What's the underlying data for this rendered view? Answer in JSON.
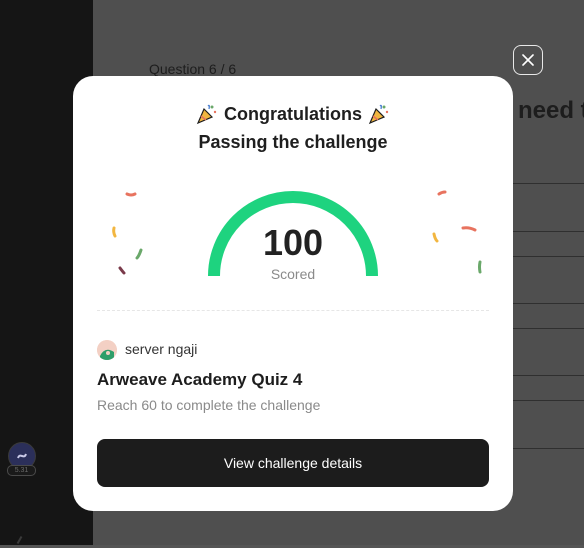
{
  "background": {
    "question_progress": "Question 6 / 6",
    "question_title_fragment": "need t",
    "rail_badge": "5.31"
  },
  "modal": {
    "heading": "Congratulations",
    "subheading": "Passing the challenge",
    "score_value": "100",
    "score_label": "Scored",
    "score_fraction": 1.0,
    "org_name": "server ngaji",
    "quiz_name": "Arweave Academy Quiz 4",
    "quiz_description": "Reach 60 to complete the challenge",
    "cta_label": "View challenge details"
  },
  "icons": {
    "close": "close-icon",
    "party": "party-popper-icon"
  },
  "colors": {
    "gauge": "#1ed37f",
    "cta_bg": "#1c1c1c",
    "confetti": [
      "#e8735f",
      "#f2b640",
      "#6aa86a",
      "#7a3a4a"
    ]
  }
}
